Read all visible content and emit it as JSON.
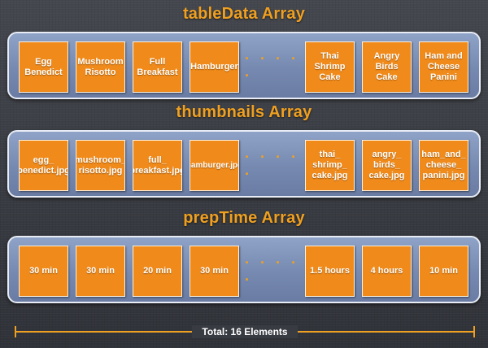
{
  "arrays": [
    {
      "title": "tableData Array",
      "cells": [
        "Egg\nBenedict",
        "Mushroom\nRisotto",
        "Full\nBreakfast",
        "Hamburger",
        "Thai\nShrimp\nCake",
        "Angry\nBirds\nCake",
        "Ham and\nCheese\nPanini"
      ]
    },
    {
      "title": "thumbnails Array",
      "cells": [
        "egg_\nbenedict.jpg",
        "mushroom_\nrisotto.jpg",
        "full_\nbreakfast.jpg",
        "hamburger.jpg",
        "thai_\nshrimp_\ncake.jpg",
        "angry_\nbirds_\ncake.jpg",
        "ham_and_\ncheese_\npanini.jpg"
      ]
    },
    {
      "title": "prepTime Array",
      "cells": [
        "30 min",
        "30 min",
        "20 min",
        "30 min",
        "1.5 hours",
        "4 hours",
        "10 min"
      ]
    }
  ],
  "ellipsis": "· · · · ·",
  "total_label": "Total: 16 Elements",
  "colors": {
    "cell_fill": "#f08a1a",
    "title_text": "#f0a020",
    "band_fill": "#7f92b8",
    "background": "#3b3e45"
  }
}
